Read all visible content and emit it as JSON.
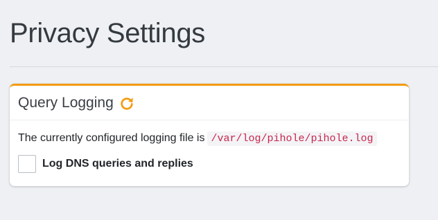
{
  "page": {
    "title": "Privacy Settings"
  },
  "card": {
    "title": "Query Logging",
    "refresh_icon": "refresh-icon",
    "accent_color": "#f39c12",
    "log_text": "The currently configured logging file is",
    "log_path": "/var/log/pihole/pihole.log",
    "checkbox_label": "Log DNS queries and replies",
    "checkbox_checked": false
  }
}
